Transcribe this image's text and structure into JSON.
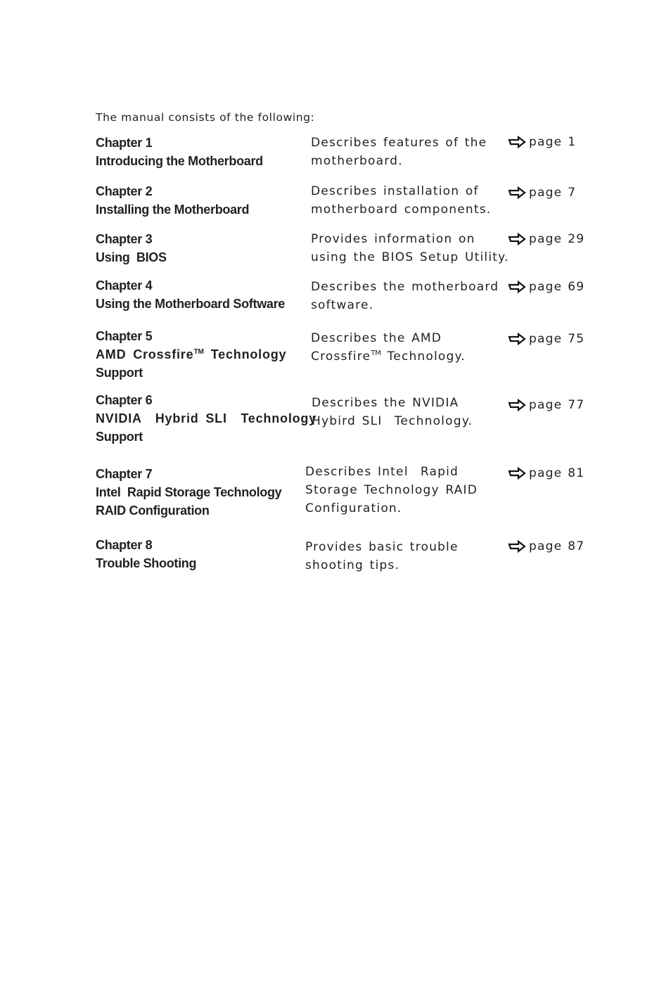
{
  "intro": "The manual consists of the following:",
  "page_label": "page",
  "icon": "right-arrow-outline-icon",
  "chapters": [
    {
      "chapter": "Chapter 1",
      "title_lines": [
        "Introducing the Motherboard"
      ],
      "desc_lines": [
        "Describes features of the",
        "motherboard."
      ],
      "page": "1"
    },
    {
      "chapter": "Chapter 2",
      "title_lines": [
        "Installing the Motherboard"
      ],
      "desc_lines": [
        "Describes installation of",
        "motherboard components."
      ],
      "page": "7"
    },
    {
      "chapter": "Chapter 3",
      "title_lines": [
        "Using  BIOS"
      ],
      "desc_lines": [
        "Provides information on",
        "using the BIOS Setup Utility."
      ],
      "page": "29"
    },
    {
      "chapter": "Chapter 4",
      "title_lines": [
        "Using the Motherboard Software"
      ],
      "desc_lines": [
        "Describes the motherboard",
        "software."
      ],
      "page": "69"
    },
    {
      "chapter": "Chapter 5",
      "title_lines": [
        "AMD Crossfire™ Technology",
        "Support"
      ],
      "desc_lines": [
        "Describes the AMD",
        "Crossfire™ Technology."
      ],
      "page": "75"
    },
    {
      "chapter": "Chapter 6",
      "title_lines": [
        "NVIDIA  Hybrid SLI  Technology",
        "Support"
      ],
      "desc_lines": [
        "Describes the NVIDIA",
        "Hybird SLI  Technology."
      ],
      "page": "77"
    },
    {
      "chapter": "Chapter 7",
      "title_lines": [
        "Intel  Rapid Storage Technology",
        "RAID Configuration"
      ],
      "desc_lines": [
        "Describes Intel  Rapid",
        "Storage Technology RAID",
        "Configuration."
      ],
      "page": "81"
    },
    {
      "chapter": "Chapter 8",
      "title_lines": [
        "Trouble Shooting"
      ],
      "desc_lines": [
        "Provides basic trouble",
        "shooting tips."
      ],
      "page": "87"
    }
  ]
}
